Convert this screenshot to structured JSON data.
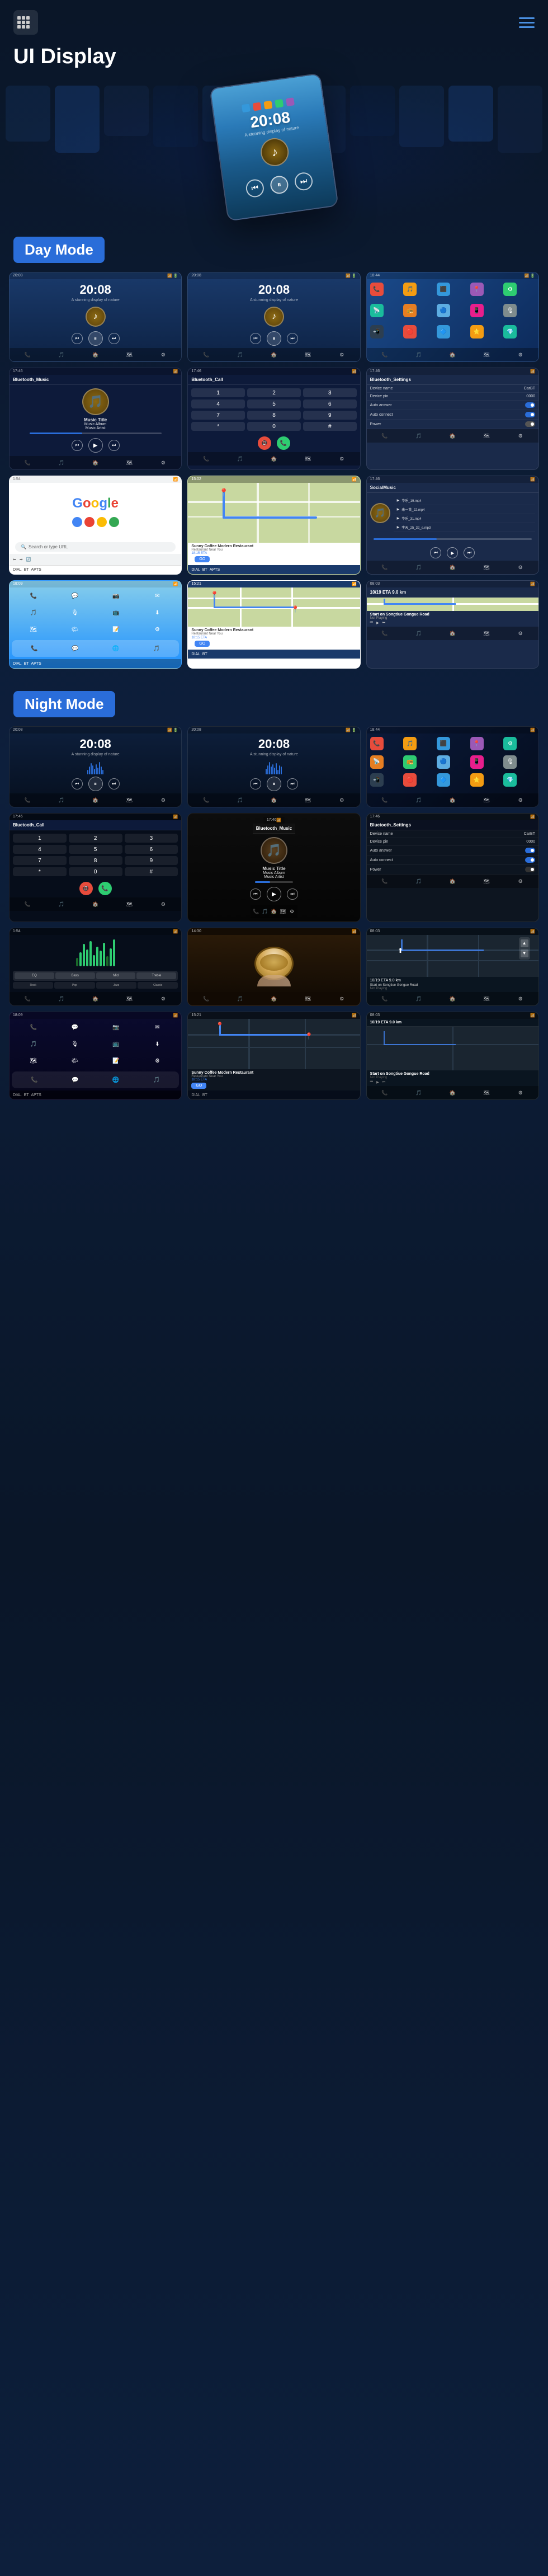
{
  "header": {
    "title": "UI Display",
    "menu_icon": "☰",
    "nav_icon": "≡"
  },
  "sections": {
    "day_mode": "Day Mode",
    "night_mode": "Night Mode"
  },
  "car_ui": {
    "time": "20:08",
    "subtitle": "A stunning display of nature",
    "music_title": "Music Title",
    "music_album": "Music Album",
    "music_artist": "Music Artist"
  },
  "settings": {
    "title": "Bluetooth_Settings",
    "device_name_label": "Device name",
    "device_name_value": "CarBT",
    "device_pin_label": "Device pin",
    "device_pin_value": "0000",
    "auto_answer_label": "Auto answer",
    "auto_connect_label": "Auto connect",
    "power_label": "Power"
  },
  "bluetooth_music": {
    "title": "Bluetooth_Music"
  },
  "bluetooth_call": {
    "title": "Bluetooth_Call"
  },
  "social": {
    "title": "SocialMusic",
    "items": [
      "华乐_19.mp4",
      "来一首_22.mp4",
      "华乐_31.mp4",
      "李天_25_32_e.mp3"
    ]
  },
  "navigation": {
    "restaurant_name": "Sunny Coffee Modern Restaurant",
    "restaurant_address": "Restaurant Near You",
    "eta_label": "18:15 ETA",
    "distance": "9.0 km",
    "time_label": "10/19 ETA  9.0 km",
    "go_button": "GO",
    "start_label": "Start on Songtiue Gongue Road",
    "not_playing": "Not Playing"
  },
  "google": {
    "logo": "Google",
    "search_placeholder": "Search or type URL"
  },
  "bottom_bar_items": [
    "📞",
    "🎵",
    "🏠",
    "🗺",
    "⚙"
  ],
  "icons": {
    "play": "▶",
    "pause": "⏸",
    "prev": "⏮",
    "next": "⏭",
    "rewind": "◀◀",
    "forward": "▶▶"
  }
}
